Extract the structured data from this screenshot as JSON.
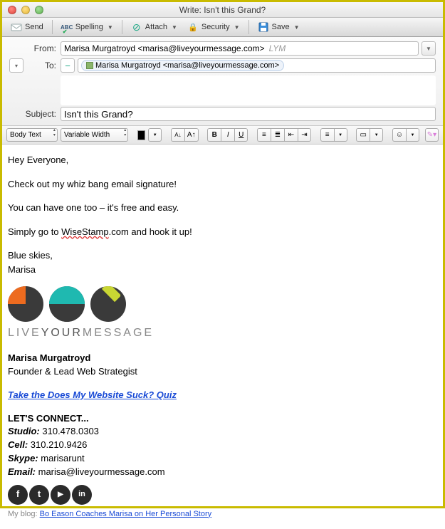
{
  "window": {
    "title": "Write: Isn't this Grand?"
  },
  "toolbar": {
    "send": "Send",
    "spelling": "Spelling",
    "attach": "Attach",
    "security": "Security",
    "save": "Save"
  },
  "headers": {
    "from_label": "From:",
    "from_value": "Marisa Murgatroyd <marisa@liveyourmessage.com>",
    "from_account": "LYM",
    "to_label": "To:",
    "to_chip": "Marisa Murgatroyd <marisa@liveyourmessage.com>",
    "subject_label": "Subject:",
    "subject_value": "Isn't this Grand?"
  },
  "format": {
    "para_style": "Body Text",
    "font_family": "Variable Width"
  },
  "body": {
    "greeting": "Hey Everyone,",
    "line1": "Check out my whiz bang email signature!",
    "line2": "You can have one too – it's free and easy.",
    "line3a": "Simply go to ",
    "line3_link": "WiseStamp",
    "line3b": ".com and hook it up!",
    "sign1": "Blue skies,",
    "sign2": "Marisa"
  },
  "signature": {
    "brand_thin": "LIVE",
    "brand_mid": "YOUR",
    "brand_thin2": "MESSAGE",
    "name": "Marisa Murgatroyd",
    "title": "Founder & Lead Web Strategist",
    "quiz_link": "Take the Does My Website Suck? Quiz",
    "connect_hdr": "LET'S CONNECT...",
    "studio_lbl": "Studio:",
    "studio_val": " 310.478.0303",
    "cell_lbl": "Cell:",
    "cell_val": " 310.210.9426",
    "skype_lbl": "Skype:",
    "skype_val": " marisarunt",
    "email_lbl": "Email:",
    "email_val": " marisa@liveyourmessage.com",
    "blog_lbl": "My blog: ",
    "blog_link": "Bo Eason Coaches Marisa on Her Personal Story",
    "social": {
      "fb": "f",
      "tw": "t",
      "yt": "▶",
      "li": "in"
    }
  }
}
